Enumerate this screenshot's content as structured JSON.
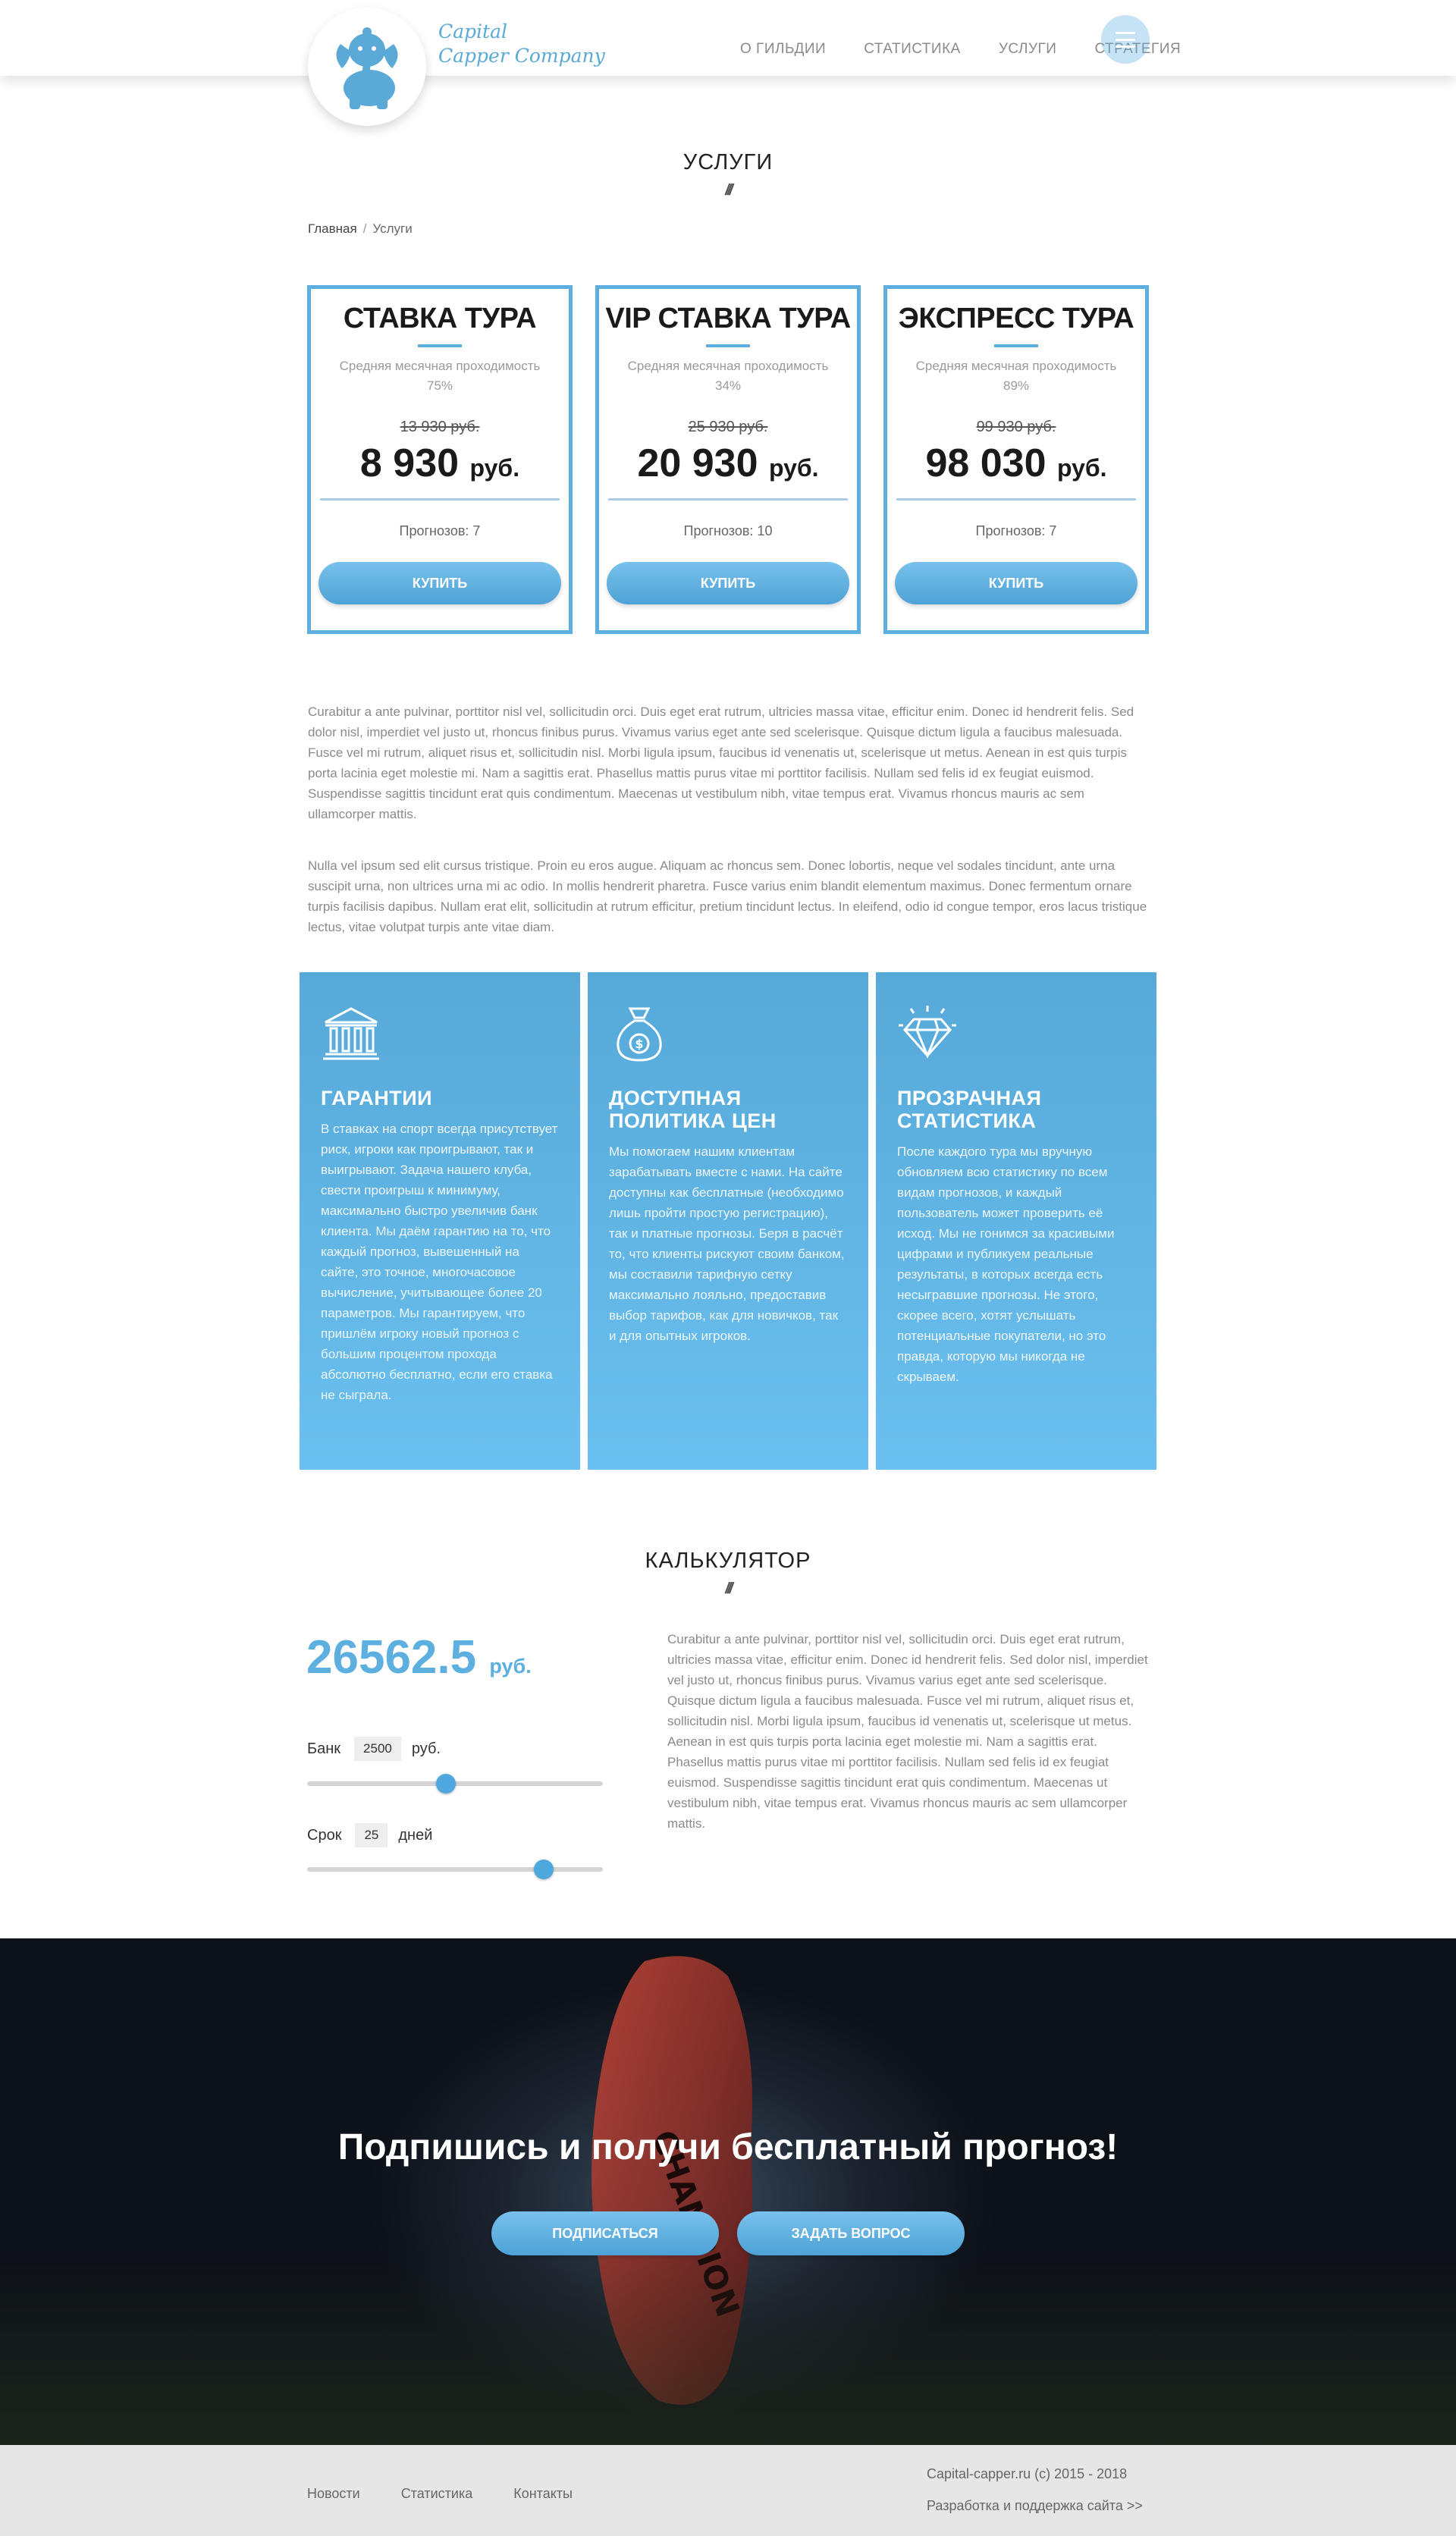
{
  "header": {
    "logo_line1": "Capital",
    "logo_line2": "Capper Company",
    "nav": [
      "О ГИЛЬДИИ",
      "СТАТИСТИКА",
      "УСЛУГИ",
      "СТРАТЕГИЯ"
    ]
  },
  "services": {
    "title": "УСЛУГИ",
    "deco": "///",
    "breadcrumb": {
      "home": "Главная",
      "separator": "/",
      "current": "Услуги"
    }
  },
  "plans": [
    {
      "name": "СТАВКА ТУРА",
      "subtitle": "Средняя месячная проходимость",
      "pass_rate": "75%",
      "old_price": "13 930 руб.",
      "price": "8 930",
      "currency": "руб.",
      "forecasts": "Прогнозов: 7",
      "button": "КУПИТЬ"
    },
    {
      "name": "VIP СТАВКА ТУРА",
      "subtitle": "Средняя месячная проходимость",
      "pass_rate": "34%",
      "old_price": "25 930 руб.",
      "price": "20 930",
      "currency": "руб.",
      "forecasts": "Прогнозов: 10",
      "button": "КУПИТЬ"
    },
    {
      "name": "ЭКСПРЕСС ТУРА",
      "subtitle": "Средняя месячная проходимость",
      "pass_rate": "89%",
      "old_price": "99 930 руб.",
      "price": "98 030",
      "currency": "руб.",
      "forecasts": "Прогнозов: 7",
      "button": "КУПИТЬ"
    }
  ],
  "paragraphs": [
    "Curabitur a ante pulvinar, porttitor nisl vel, sollicitudin orci. Duis eget erat rutrum, ultricies massa vitae, efficitur enim. Donec id hendrerit felis. Sed dolor nisl, imperdiet vel justo ut, rhoncus finibus purus. Vivamus varius eget ante sed scelerisque. Quisque dictum ligula a faucibus malesuada. Fusce vel mi rutrum, aliquet risus et, sollicitudin nisl. Morbi ligula ipsum, faucibus id venenatis ut, scelerisque ut metus. Aenean in est quis turpis porta lacinia eget molestie mi. Nam a sagittis erat. Phasellus mattis purus vitae mi porttitor facilisis. Nullam sed felis id ex feugiat euismod. Suspendisse sagittis tincidunt erat quis condimentum. Maecenas ut vestibulum nibh, vitae tempus erat. Vivamus rhoncus mauris ac sem ullamcorper mattis.",
    "Nulla vel ipsum sed elit cursus tristique. Proin eu eros augue. Aliquam ac rhoncus sem. Donec lobortis, neque vel sodales tincidunt, ante urna suscipit urna, non ultrices urna mi ac odio. In mollis hendrerit pharetra. Fusce varius enim blandit elementum maximus. Donec fermentum ornare turpis facilisis dapibus. Nullam erat elit, sollicitudin at rutrum efficitur, pretium tincidunt lectus. In eleifend, odio id congue tempor, eros lacus tristique lectus, vitae volutpat turpis ante vitae diam."
  ],
  "features": [
    {
      "icon": "bank-icon",
      "title": "ГАРАНТИИ",
      "text": "В ставках на спорт всегда присутствует риск, игроки как проигрывают, так и выигрывают. Задача нашего клуба, свести проигрыш к минимуму, максимально быстро увеличив банк клиента. Мы даём гарантию на то, что каждый прогноз, вывешенный на сайте, это точное, многочасовое вычисление, учитывающее более 20 параметров. Мы гарантируем, что пришлём игроку новый прогноз с большим процентом прохода абсолютно бесплатно, если его ставка не сыграла."
    },
    {
      "icon": "money-bag-icon",
      "title": "ДОСТУПНАЯ ПОЛИТИКА ЦЕН",
      "text": "Мы помогаем нашим клиентам зарабатывать вместе с нами. На сайте доступны как бесплатные (необходимо лишь пройти простую регистрацию), так и платные прогнозы. Беря в расчёт то, что клиенты рискуют своим банком, мы составили тарифную сетку максимально лояльно, предоставив выбор тарифов, как для новичков, так и для опытных игроков."
    },
    {
      "icon": "diamond-icon",
      "title": "ПРОЗРАЧНАЯ СТАТИСТИКА",
      "text": "После каждого тура мы вручную обновляем всю статистику по всем видам прогнозов, и каждый пользователь может проверить её исход. Мы не гонимся за красивыми цифрами и публикуем реальные результаты, в которых всегда есть несыгравшие прогнозы. Не этого, скорее всего, хотят услышать потенциальные покупатели, но это правда, которую мы никогда не скрываем."
    }
  ],
  "calculator": {
    "title": "КАЛЬКУЛЯТОР",
    "deco": "///",
    "result": "26562.5",
    "result_currency": "руб.",
    "bank_label": "Банк",
    "bank_value": "2500",
    "bank_unit": "руб.",
    "bank_slider_fraction": 0.47,
    "term_label": "Срок",
    "term_value": "25",
    "term_unit": "дней",
    "term_slider_fraction": 0.8,
    "text": "Curabitur a ante pulvinar, porttitor nisl vel, sollicitudin orci. Duis eget erat rutrum, ultricies massa vitae, efficitur enim. Donec id hendrerit felis. Sed dolor nisl, imperdiet vel justo ut, rhoncus finibus purus. Vivamus varius eget ante sed scelerisque. Quisque dictum ligula a faucibus malesuada. Fusce vel mi rutrum, aliquet risus et, sollicitudin nisl. Morbi ligula ipsum, faucibus id venenatis ut, scelerisque ut metus. Aenean in est quis turpis porta lacinia eget molestie mi. Nam a sagittis erat. Phasellus mattis purus vitae mi porttitor facilisis. Nullam sed felis id ex feugiat euismod. Suspendisse sagittis tincidunt erat quis condimentum. Maecenas ut vestibulum nibh, vitae tempus erat. Vivamus rhoncus mauris ac sem ullamcorper mattis."
  },
  "banner": {
    "heading": "Подпишись и получи бесплатный прогноз!",
    "subscribe_button": "ПОДПИСАТЬСЯ",
    "ask_button": "ЗАДАТЬ ВОПРОС",
    "boot_text": "CHAMPION"
  },
  "footer": {
    "links": [
      "Новости",
      "Статистика",
      "Контакты"
    ],
    "copyright": "Capital-capper.ru (c) 2015 - 2018",
    "developer": "Разработка и поддержка сайта >>"
  },
  "colors": {
    "accent": "#5dafe0",
    "text_gray": "#8a8a8a",
    "footer_bg": "#e6e6e6"
  }
}
